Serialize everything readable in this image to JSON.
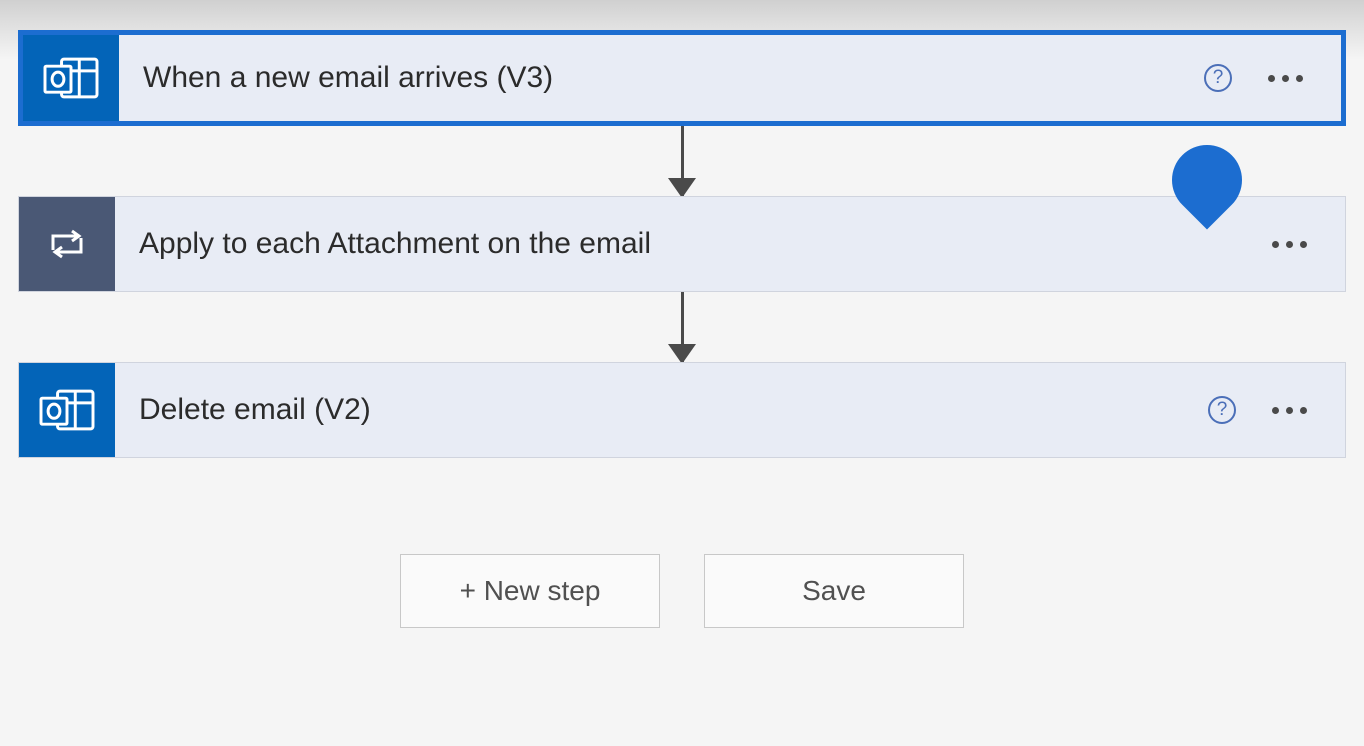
{
  "steps": [
    {
      "title": "When a new email arrives (V3)",
      "icon_type": "outlook",
      "selected": true,
      "has_help": true
    },
    {
      "title": "Apply to each Attachment on the email",
      "icon_type": "control",
      "selected": false,
      "has_help": false
    },
    {
      "title": "Delete email (V2)",
      "icon_type": "outlook",
      "selected": false,
      "has_help": true
    }
  ],
  "footer": {
    "new_step_label": "+ New step",
    "save_label": "Save"
  },
  "colors": {
    "outlook_blue": "#0364b8",
    "control_slate": "#4a5875",
    "selection_blue": "#1c6dd0",
    "card_bg": "#e8ecf5"
  }
}
